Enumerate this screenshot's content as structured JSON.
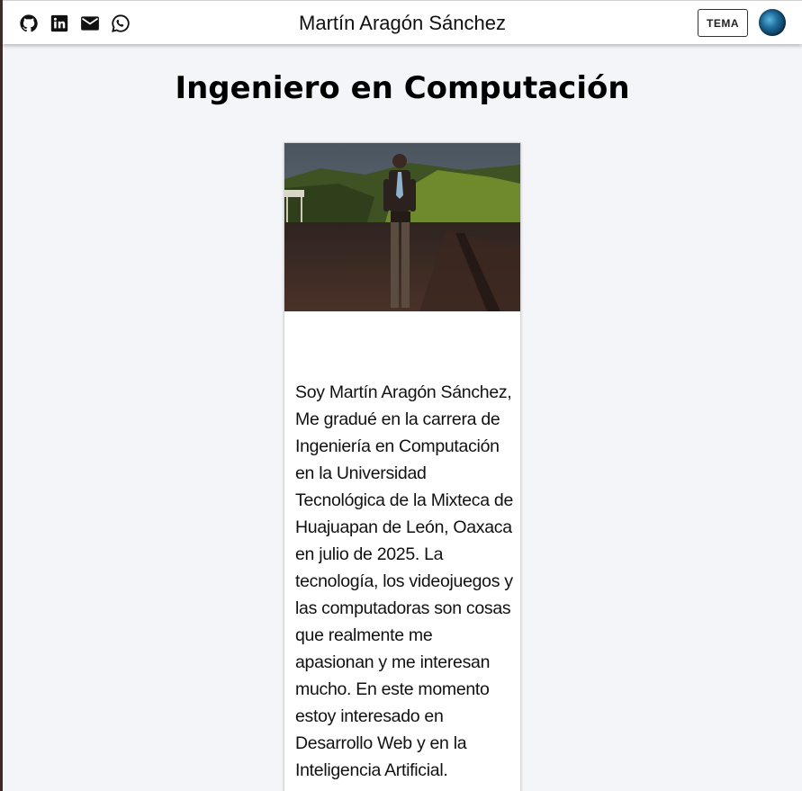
{
  "header": {
    "title": "Martín Aragón Sánchez",
    "theme_button": "TEMA",
    "social_icons": [
      "github-icon",
      "linkedin-icon",
      "email-icon",
      "whatsapp-icon"
    ],
    "avatar_icon": "globe-avatar"
  },
  "main": {
    "heading": "Ingeniero en Computación",
    "card": {
      "bio": "Soy Martín Aragón Sánchez, Me gradué en la carrera de Ingeniería en Computación en la Universidad Tecnológica de la Mixteca de Huajuapan de León, Oaxaca en julio de 2025. La tecnología, los videojuegos y las computadoras son cosas que realmente me apasionan y me interesan mucho. En este momento estoy interesado en Desarrollo Web y en la Inteligencia Artificial."
    }
  },
  "colors": {
    "page_bg": "#f4f5f9",
    "topbar_bg": "#ffffff",
    "side_border": "#3e2a26"
  }
}
